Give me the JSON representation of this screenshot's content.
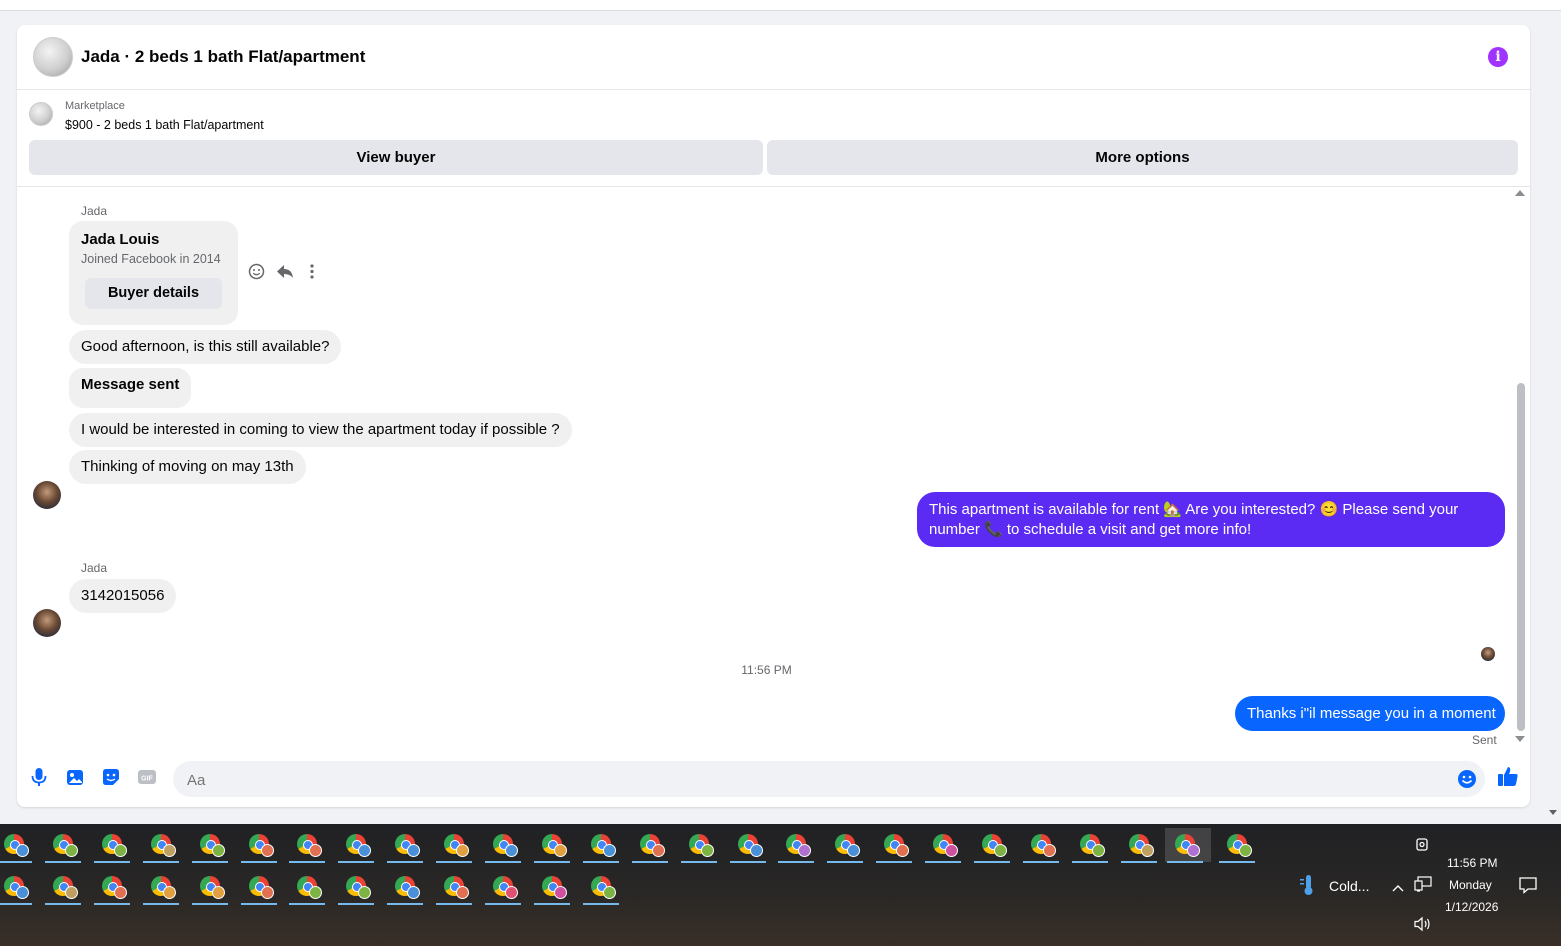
{
  "conversation": {
    "title": "Jada · 2 beds 1 bath Flat/apartment",
    "info_icon": "info-icon",
    "info_glyph": "i"
  },
  "marketplace": {
    "label": "Marketplace",
    "listing": "$900 - 2 beds 1 bath Flat/apartment",
    "view_buyer": "View buyer",
    "more_options": "More options"
  },
  "messages": {
    "sender1": "Jada",
    "profile_name": "Jada Louis",
    "profile_joined": "Joined Facebook in 2014",
    "buyer_details": "Buyer details",
    "in1": "Good afternoon, is this still available?",
    "in2": "Message sent",
    "in3": "I would be interested in coming to view the apartment today if possible ?",
    "in4": "Thinking of moving on may 13th",
    "out1": "This apartment is available for rent 🏡 Are you interested? 😊 Please send your number 📞 to schedule a visit and get more info!",
    "sender2": "Jada",
    "in5": "3142015056",
    "timestamp": "11:56 PM",
    "out2": "Thanks i\"il message you in a moment",
    "status": "Sent"
  },
  "composer": {
    "placeholder": "Aa",
    "icons": [
      "microphone-icon",
      "photo-icon",
      "sticker-icon",
      "gif-icon",
      "emoji-icon",
      "like-icon"
    ],
    "gif_label": "GIF"
  },
  "colors": {
    "out_bubble_1": "#5b2bf3",
    "out_bubble_2": "#0866ff",
    "accent": "#0084ff",
    "info": "#a033ff"
  },
  "taskbar": {
    "weather": "Cold...",
    "time": "11:56 PM",
    "day": "Monday",
    "date": "1/12/2026",
    "row1_badges": [
      "#4a90d9",
      "#7cb342",
      "#7cb342",
      "#c0a060",
      "#7cb342",
      "#e07050",
      "#e07050",
      "#4a90d9",
      "#4a90d9",
      "#e0a040",
      "#4a90d9",
      "#e0a040",
      "#4a90d9",
      "#e07050",
      "#7cb342",
      "#4a90d9",
      "#b070d0",
      "#4a90d9",
      "#e07050",
      "#d050a0",
      "#7cb342",
      "#e07050",
      "#7cb342",
      "#c0a060",
      "#b070d0",
      "#7cb342"
    ],
    "row2_badges": [
      "#4a90d9",
      "#c0a060",
      "#e07050",
      "#e0a040",
      "#e0a040",
      "#e07050",
      "#7cb342",
      "#7cb342",
      "#4a90d9",
      "#e07050",
      "#e05070",
      "#d050a0",
      "#7cb342"
    ]
  }
}
